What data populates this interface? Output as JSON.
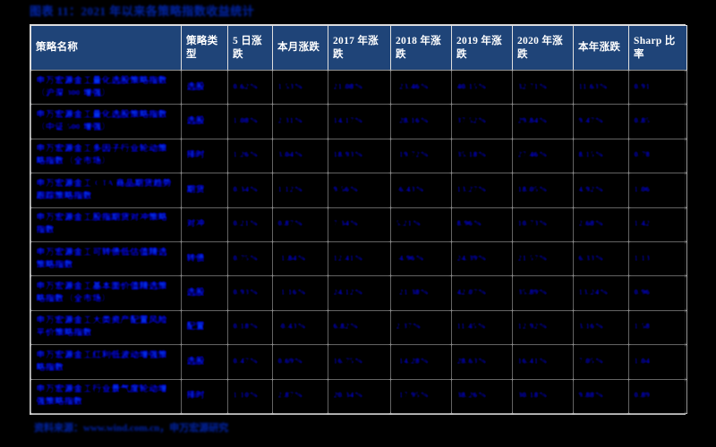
{
  "figure": {
    "title": "图表 11：2021 年以来各策略指数收益统计"
  },
  "table": {
    "columns": [
      {
        "key": "name",
        "label": "策略名称"
      },
      {
        "key": "type",
        "label": "策略类型"
      },
      {
        "key": "d5",
        "label": "5 日涨跌"
      },
      {
        "key": "month",
        "label": "本月涨跌"
      },
      {
        "key": "y2017",
        "label": "2017 年涨跌"
      },
      {
        "key": "y2018",
        "label": "2018 年涨跌"
      },
      {
        "key": "y2019",
        "label": "2019 年涨跌"
      },
      {
        "key": "y2020",
        "label": "2020 年涨跌"
      },
      {
        "key": "ytd",
        "label": "本年涨跌"
      },
      {
        "key": "sharp",
        "label": "Sharp 比率"
      }
    ],
    "rows": [
      {
        "name": "申万宏源金工量化选股策略指数（沪深 300 增强）",
        "type": "选股",
        "d5": "0.62%",
        "month": "1.53%",
        "y2017": "21.08%",
        "y2018": "-23.46%",
        "y2019": "40.15%",
        "y2020": "32.71%",
        "ytd": "11.63%",
        "sharp": "0.91"
      },
      {
        "name": "申万宏源金工量化选股策略指数（中证 500 增强）",
        "type": "选股",
        "d5": "1.08%",
        "month": "2.31%",
        "y2017": "14.17%",
        "y2018": "-28.16%",
        "y2019": "37.52%",
        "y2020": "29.84%",
        "ytd": "9.47%",
        "sharp": "0.85"
      },
      {
        "name": "申万宏源金工多因子行业轮动策略指数（全市场）",
        "type": "择时",
        "d5": "1.26%",
        "month": "3.04%",
        "y2017": "18.93%",
        "y2018": "-19.72%",
        "y2019": "35.18%",
        "y2020": "27.46%",
        "ytd": "8.15%",
        "sharp": "0.78"
      },
      {
        "name": "申万宏源金工 CTA 商品期货趋势跟踪策略指数",
        "type": "期货",
        "d5": "0.34%",
        "month": "1.12%",
        "y2017": "9.56%",
        "y2018": "-6.43%",
        "y2019": "13.27%",
        "y2020": "18.05%",
        "ytd": "4.92%",
        "sharp": "1.06"
      },
      {
        "name": "申万宏源金工股指期货对冲策略指数",
        "type": "对冲",
        "d5": "0.21%",
        "month": "0.87%",
        "y2017": "7.34%",
        "y2018": "5.21%",
        "y2019": "8.96%",
        "y2020": "10.73%",
        "ytd": "2.68%",
        "sharp": "1.42"
      },
      {
        "name": "申万宏源金工可转债低估值精选策略指数",
        "type": "转债",
        "d5": "0.75%",
        "month": "-1.84%",
        "y2017": "12.41%",
        "y2018": "-4.96%",
        "y2019": "24.39%",
        "y2020": "21.57%",
        "ytd": "6.33%",
        "sharp": "1.13"
      },
      {
        "name": "申万宏源金工基本面价值精选策略指数（全市场）",
        "type": "选股",
        "d5": "0.93%",
        "month": "-1.16%",
        "y2017": "24.12%",
        "y2018": "-21.38%",
        "y2019": "42.07%",
        "y2020": "35.89%",
        "ytd": "13.24%",
        "sharp": "0.96"
      },
      {
        "name": "申万宏源金工大类资产配置风险平价策略指数",
        "type": "配置",
        "d5": "0.18%",
        "month": "-0.43%",
        "y2017": "6.82%",
        "y2018": "2.37%",
        "y2019": "11.45%",
        "y2020": "12.92%",
        "ytd": "3.16%",
        "sharp": "1.58"
      },
      {
        "name": "申万宏源金工红利低波动增强策略指数",
        "type": "选股",
        "d5": "0.47%",
        "month": "0.69%",
        "y2017": "16.75%",
        "y2018": "-14.28%",
        "y2019": "28.63%",
        "y2020": "16.41%",
        "ytd": "7.05%",
        "sharp": "1.04"
      },
      {
        "name": "申万宏源金工行业景气度轮动增强策略指数",
        "type": "择时",
        "d5": "1.10%",
        "month": "2.87%",
        "y2017": "20.34%",
        "y2018": "-17.95%",
        "y2019": "38.26%",
        "y2020": "30.18%",
        "ytd": "9.88%",
        "sharp": "0.89"
      }
    ]
  },
  "source": {
    "note": "资料来源：www.wind.com.cn，申万宏源研究"
  },
  "colors": {
    "header_bg": "#1f4478",
    "header_text": "#ffffff",
    "body_text": "#1d56a5",
    "page_bg": "#000000",
    "grid_line": "#e0e0e0",
    "title_text": "#1b4a8c"
  }
}
